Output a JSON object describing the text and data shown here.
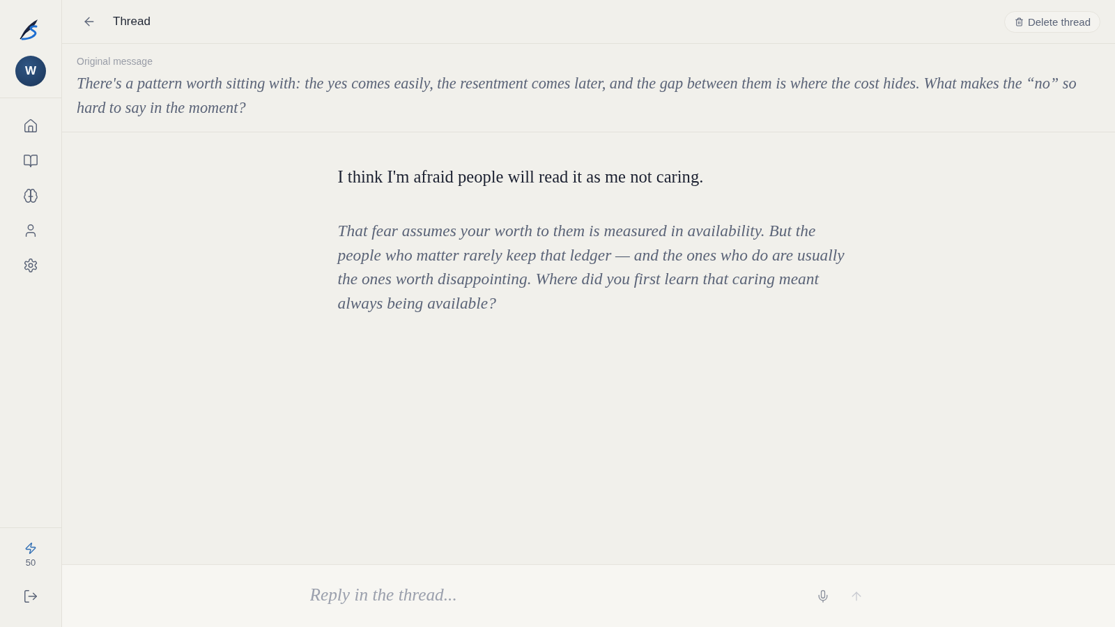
{
  "sidebar": {
    "avatar": {
      "initial": "W"
    },
    "credits": {
      "count": "50"
    }
  },
  "header": {
    "title": "Thread",
    "delete_button": {
      "label": "Delete thread"
    }
  },
  "original_message": {
    "label": "Original message",
    "text": "There's a pattern worth sitting with: the yes comes easily, the resentment comes later, and the gap between them is where the cost hides. What makes the “no” so hard to say in the moment?"
  },
  "messages": [
    {
      "kind": "user",
      "text": "I think I'm afraid people will read it as me not caring."
    },
    {
      "kind": "assistant",
      "text": "That fear assumes your worth to them is measured in availability. But the people who matter rarely keep that ledger — and the ones who do are usually the ones worth disappointing. Where did you first learn that caring meant always being available?"
    }
  ],
  "composer": {
    "placeholder": "Reply in the thread...",
    "send_disabled": true
  }
}
